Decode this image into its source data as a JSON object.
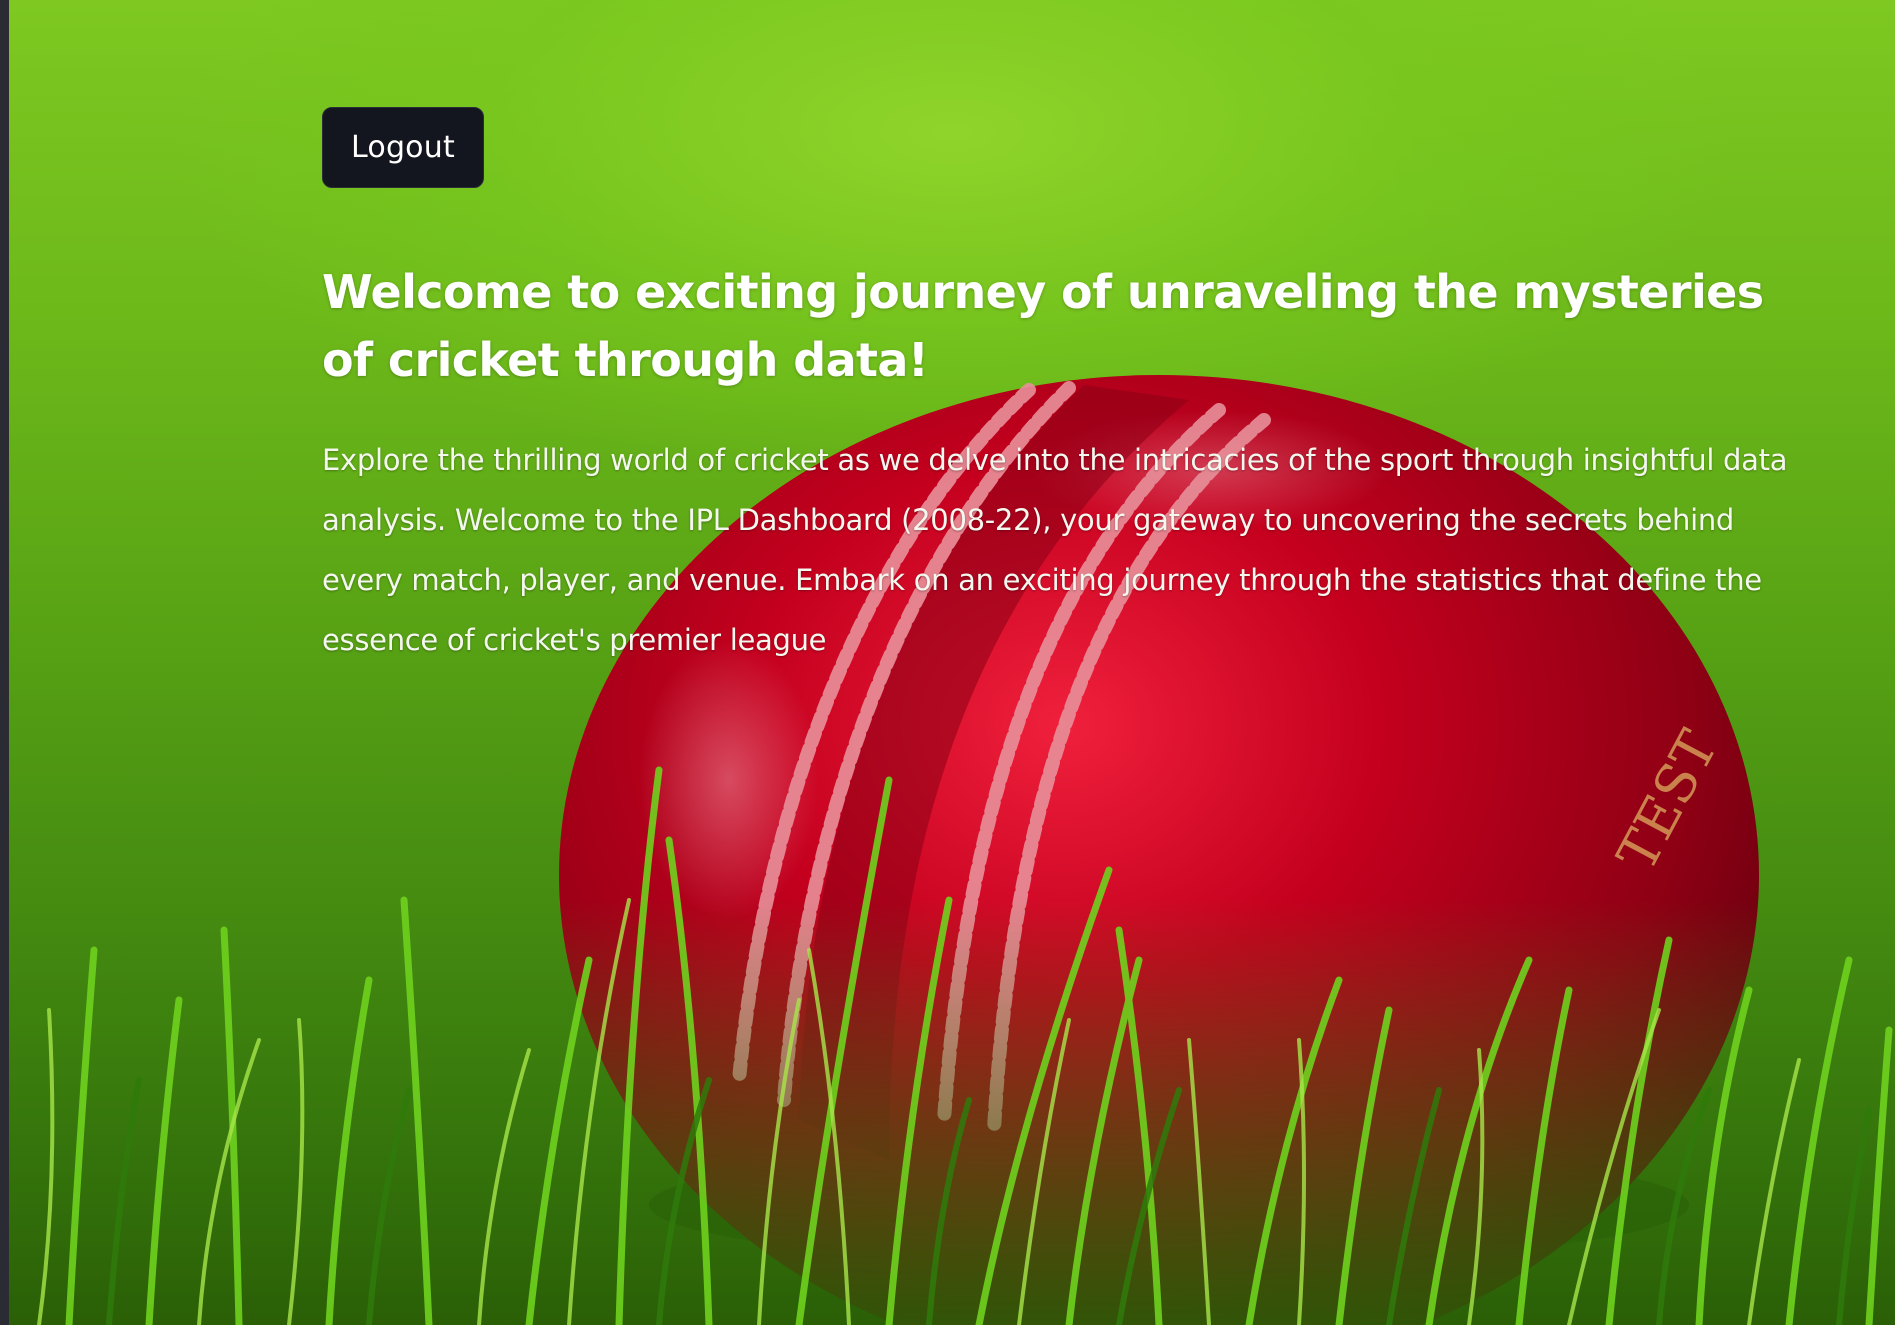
{
  "header": {
    "logout_label": "Logout"
  },
  "hero": {
    "headline": "Welcome to exciting journey of unraveling the mysteries of cricket through data!",
    "intro": "Explore the thrilling world of cricket as we delve into the intricacies of the sport through insightful data analysis. Welcome to the IPL Dashboard (2008-22), your gateway to uncovering the secrets behind every match, player, and venue. Embark on an exciting journey through the statistics that define the essence of cricket's premier league"
  },
  "background": {
    "ball_text": "TEST",
    "colors": {
      "grass_light": "#7ec821",
      "grass_dark": "#2f6a0a",
      "ball_red": "#b3001e",
      "seam": "#e8909a",
      "button_bg": "#14161f"
    }
  }
}
